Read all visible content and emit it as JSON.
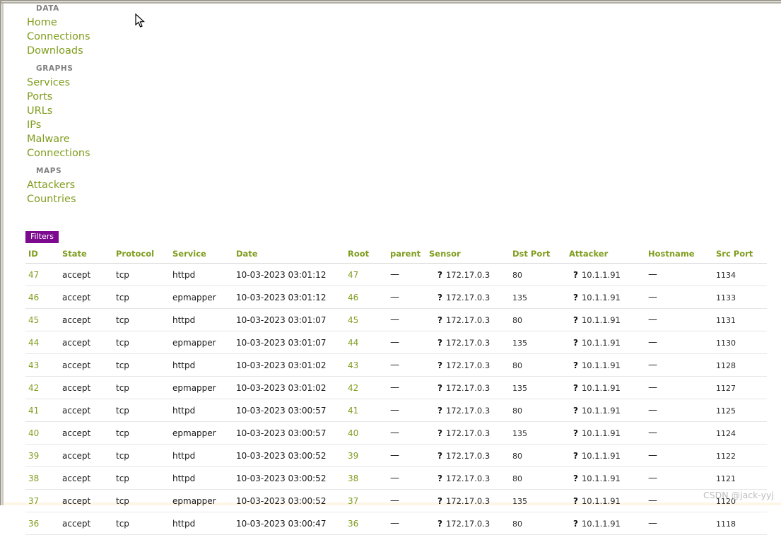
{
  "sidebar": {
    "groups": [
      {
        "heading": "DATA",
        "items": [
          {
            "label": "Home"
          },
          {
            "label": "Connections"
          },
          {
            "label": "Downloads"
          }
        ]
      },
      {
        "heading": "GRAPHS",
        "items": [
          {
            "label": "Services"
          },
          {
            "label": "Ports"
          },
          {
            "label": "URLs"
          },
          {
            "label": "IPs"
          },
          {
            "label": "Malware"
          },
          {
            "label": "Connections"
          }
        ]
      },
      {
        "heading": "MAPS",
        "items": [
          {
            "label": "Attackers"
          },
          {
            "label": "Countries"
          }
        ]
      }
    ]
  },
  "toolbar": {
    "filters_label": "Filters",
    "filters_bg": "#7b0a8f",
    "filters_fg": "#ffffff"
  },
  "colors": {
    "accent_green": "#7f9d1e",
    "heading_gray": "#808080",
    "row_divider": "#e6e6e6",
    "frame_gray": "#9d9a90"
  },
  "table": {
    "columns": [
      {
        "key": "id",
        "label": "ID"
      },
      {
        "key": "state",
        "label": "State"
      },
      {
        "key": "protocol",
        "label": "Protocol"
      },
      {
        "key": "service",
        "label": "Service"
      },
      {
        "key": "date",
        "label": "Date"
      },
      {
        "key": "root",
        "label": "Root"
      },
      {
        "key": "parent",
        "label": "parent"
      },
      {
        "key": "sensor",
        "label": "Sensor"
      },
      {
        "key": "dst_port",
        "label": "Dst Port"
      },
      {
        "key": "attacker",
        "label": "Attacker"
      },
      {
        "key": "hostname",
        "label": "Hostname"
      },
      {
        "key": "src_port",
        "label": "Src Port"
      }
    ],
    "icons": {
      "unknown_flag": "?"
    },
    "empty_value": "—",
    "rows": [
      {
        "id": "47",
        "state": "accept",
        "protocol": "tcp",
        "service": "httpd",
        "date": "10-03-2023 03:01:12",
        "root": "47",
        "parent": "—",
        "sensor": "172.17.0.3",
        "dst_port": "80",
        "attacker": "10.1.1.91",
        "hostname": "—",
        "src_port": "1134"
      },
      {
        "id": "46",
        "state": "accept",
        "protocol": "tcp",
        "service": "epmapper",
        "date": "10-03-2023 03:01:12",
        "root": "46",
        "parent": "—",
        "sensor": "172.17.0.3",
        "dst_port": "135",
        "attacker": "10.1.1.91",
        "hostname": "—",
        "src_port": "1133"
      },
      {
        "id": "45",
        "state": "accept",
        "protocol": "tcp",
        "service": "httpd",
        "date": "10-03-2023 03:01:07",
        "root": "45",
        "parent": "—",
        "sensor": "172.17.0.3",
        "dst_port": "80",
        "attacker": "10.1.1.91",
        "hostname": "—",
        "src_port": "1131"
      },
      {
        "id": "44",
        "state": "accept",
        "protocol": "tcp",
        "service": "epmapper",
        "date": "10-03-2023 03:01:07",
        "root": "44",
        "parent": "—",
        "sensor": "172.17.0.3",
        "dst_port": "135",
        "attacker": "10.1.1.91",
        "hostname": "—",
        "src_port": "1130"
      },
      {
        "id": "43",
        "state": "accept",
        "protocol": "tcp",
        "service": "httpd",
        "date": "10-03-2023 03:01:02",
        "root": "43",
        "parent": "—",
        "sensor": "172.17.0.3",
        "dst_port": "80",
        "attacker": "10.1.1.91",
        "hostname": "—",
        "src_port": "1128"
      },
      {
        "id": "42",
        "state": "accept",
        "protocol": "tcp",
        "service": "epmapper",
        "date": "10-03-2023 03:01:02",
        "root": "42",
        "parent": "—",
        "sensor": "172.17.0.3",
        "dst_port": "135",
        "attacker": "10.1.1.91",
        "hostname": "—",
        "src_port": "1127"
      },
      {
        "id": "41",
        "state": "accept",
        "protocol": "tcp",
        "service": "httpd",
        "date": "10-03-2023 03:00:57",
        "root": "41",
        "parent": "—",
        "sensor": "172.17.0.3",
        "dst_port": "80",
        "attacker": "10.1.1.91",
        "hostname": "—",
        "src_port": "1125"
      },
      {
        "id": "40",
        "state": "accept",
        "protocol": "tcp",
        "service": "epmapper",
        "date": "10-03-2023 03:00:57",
        "root": "40",
        "parent": "—",
        "sensor": "172.17.0.3",
        "dst_port": "135",
        "attacker": "10.1.1.91",
        "hostname": "—",
        "src_port": "1124"
      },
      {
        "id": "39",
        "state": "accept",
        "protocol": "tcp",
        "service": "httpd",
        "date": "10-03-2023 03:00:52",
        "root": "39",
        "parent": "—",
        "sensor": "172.17.0.3",
        "dst_port": "80",
        "attacker": "10.1.1.91",
        "hostname": "—",
        "src_port": "1122"
      },
      {
        "id": "38",
        "state": "accept",
        "protocol": "tcp",
        "service": "httpd",
        "date": "10-03-2023 03:00:52",
        "root": "38",
        "parent": "—",
        "sensor": "172.17.0.3",
        "dst_port": "80",
        "attacker": "10.1.1.91",
        "hostname": "—",
        "src_port": "1121"
      },
      {
        "id": "37",
        "state": "accept",
        "protocol": "tcp",
        "service": "epmapper",
        "date": "10-03-2023 03:00:52",
        "root": "37",
        "parent": "—",
        "sensor": "172.17.0.3",
        "dst_port": "135",
        "attacker": "10.1.1.91",
        "hostname": "—",
        "src_port": "1120"
      },
      {
        "id": "36",
        "state": "accept",
        "protocol": "tcp",
        "service": "httpd",
        "date": "10-03-2023 03:00:47",
        "root": "36",
        "parent": "—",
        "sensor": "172.17.0.3",
        "dst_port": "80",
        "attacker": "10.1.1.91",
        "hostname": "—",
        "src_port": "1118"
      }
    ]
  },
  "watermark": {
    "text": "CSDN @jack-yyj"
  }
}
